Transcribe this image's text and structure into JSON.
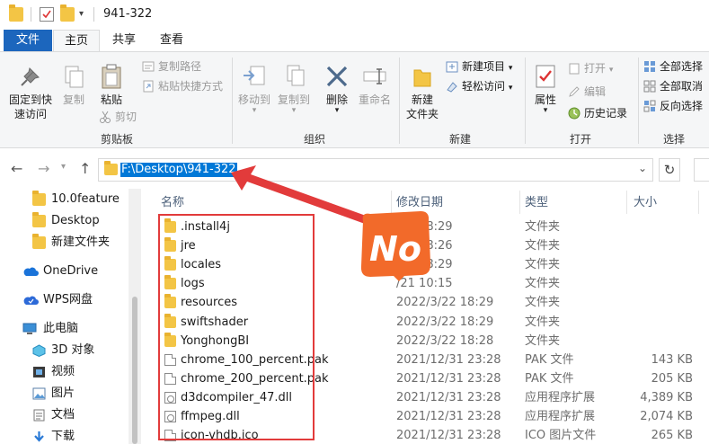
{
  "window": {
    "title": "941-322"
  },
  "tabs": [
    {
      "label": "文件"
    },
    {
      "label": "主页"
    },
    {
      "label": "共享"
    },
    {
      "label": "查看"
    }
  ],
  "ribbon": {
    "clipboard": {
      "group_label": "剪贴板",
      "pin_label_1": "固定到快",
      "pin_label_2": "速访问",
      "copy": "复制",
      "paste": "粘贴",
      "copy_path": "复制路径",
      "paste_shortcut": "粘贴快捷方式",
      "cut": "剪切"
    },
    "organize": {
      "group_label": "组织",
      "move_to": "移动到",
      "copy_to": "复制到",
      "delete": "删除",
      "rename": "重命名"
    },
    "new": {
      "group_label": "新建",
      "new_folder_1": "新建",
      "new_folder_2": "文件夹",
      "new_item": "新建项目",
      "easy_access": "轻松访问"
    },
    "open": {
      "group_label": "打开",
      "properties": "属性",
      "open": "打开",
      "edit": "编辑",
      "history": "历史记录"
    },
    "select": {
      "group_label": "选择",
      "select_all": "全部选择",
      "select_none": "全部取消",
      "invert": "反向选择"
    }
  },
  "address": {
    "path": "F:\\Desktop\\941-322"
  },
  "nav": {
    "items": [
      {
        "label": "10.0feature"
      },
      {
        "label": "Desktop"
      },
      {
        "label": "新建文件夹"
      },
      {
        "label": "OneDrive"
      },
      {
        "label": "WPS网盘"
      },
      {
        "label": "此电脑"
      },
      {
        "label": "3D 对象"
      },
      {
        "label": "视频"
      },
      {
        "label": "图片"
      },
      {
        "label": "文档"
      },
      {
        "label": "下载"
      }
    ]
  },
  "list": {
    "columns": {
      "name": "名称",
      "date": "修改日期",
      "type": "类型",
      "size": "大小"
    },
    "rows": [
      {
        "name": ".install4j",
        "date": "/22 18:29",
        "type": "文件夹",
        "size": "",
        "kind": "folder"
      },
      {
        "name": "jre",
        "date": "/22 18:26",
        "type": "文件夹",
        "size": "",
        "kind": "folder"
      },
      {
        "name": "locales",
        "date": "/22 18:29",
        "type": "文件夹",
        "size": "",
        "kind": "folder"
      },
      {
        "name": "logs",
        "date": "/21 10:15",
        "type": "文件夹",
        "size": "",
        "kind": "folder"
      },
      {
        "name": "resources",
        "date": "2022/3/22 18:29",
        "type": "文件夹",
        "size": "",
        "kind": "folder"
      },
      {
        "name": "swiftshader",
        "date": "2022/3/22 18:29",
        "type": "文件夹",
        "size": "",
        "kind": "folder"
      },
      {
        "name": "YonghongBI",
        "date": "2022/3/22 18:28",
        "type": "文件夹",
        "size": "",
        "kind": "folder"
      },
      {
        "name": "chrome_100_percent.pak",
        "date": "2021/12/31 23:28",
        "type": "PAK 文件",
        "size": "143 KB",
        "kind": "file"
      },
      {
        "name": "chrome_200_percent.pak",
        "date": "2021/12/31 23:28",
        "type": "PAK 文件",
        "size": "205 KB",
        "kind": "file"
      },
      {
        "name": "d3dcompiler_47.dll",
        "date": "2021/12/31 23:28",
        "type": "应用程序扩展",
        "size": "4,389 KB",
        "kind": "dll"
      },
      {
        "name": "ffmpeg.dll",
        "date": "2021/12/31 23:28",
        "type": "应用程序扩展",
        "size": "2,074 KB",
        "kind": "dll"
      },
      {
        "name": "icon-vhdb.ico",
        "date": "2021/12/31 23:28",
        "type": "ICO 图片文件",
        "size": "265 KB",
        "kind": "file"
      }
    ]
  },
  "annotation": {
    "sticker_text": "No",
    "colors": {
      "box": "#e23b3b",
      "arrow": "#e23b3b",
      "sticker": "#f26a2a"
    }
  }
}
